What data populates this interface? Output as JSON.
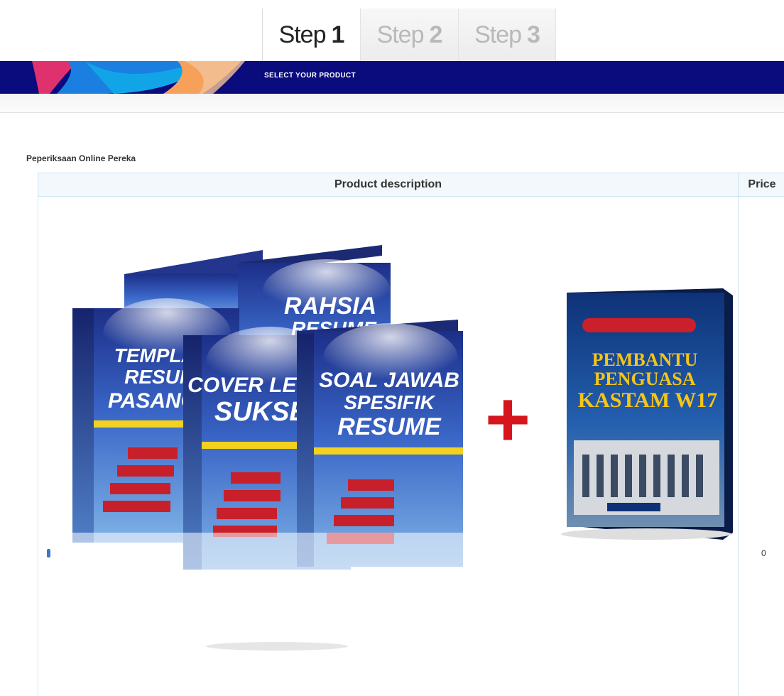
{
  "steps": [
    {
      "word": "Step",
      "number": "1",
      "active": true
    },
    {
      "word": "Step",
      "number": "2",
      "active": false
    },
    {
      "word": "Step",
      "number": "3",
      "active": false
    }
  ],
  "banner": {
    "subtitle": "SELECT YOUR PRODUCT"
  },
  "section": {
    "title": "Peperiksaan Online Pereka"
  },
  "table": {
    "headers": {
      "description": "Product description",
      "price": "Price"
    },
    "price_clip": "0"
  },
  "product": {
    "books": [
      {
        "title_lines": [
          "RAHSIA",
          "RESUME"
        ]
      },
      {
        "title_lines": [
          "TEMPLATE",
          "RESUME",
          "PASANG"
        ]
      },
      {
        "title_lines": [
          "COVER LETTER",
          "SUKSES"
        ]
      },
      {
        "title_lines": [
          "SOAL JAWAB",
          "SPESIFIK",
          "RESUME"
        ]
      }
    ],
    "plus_symbol": "+",
    "bonus_book": {
      "title_lines": [
        "PEMBANTU",
        "PENGUASA",
        "KASTAM W17"
      ]
    }
  },
  "colors": {
    "banner": "#0a0b7d",
    "book_blue": "#2b4fa8",
    "book_title": "#ffffff",
    "plus": "#d7151d",
    "bonus_title": "#f5c518",
    "header_bg": "#f2f8fc",
    "table_border": "#cfe4f2"
  }
}
